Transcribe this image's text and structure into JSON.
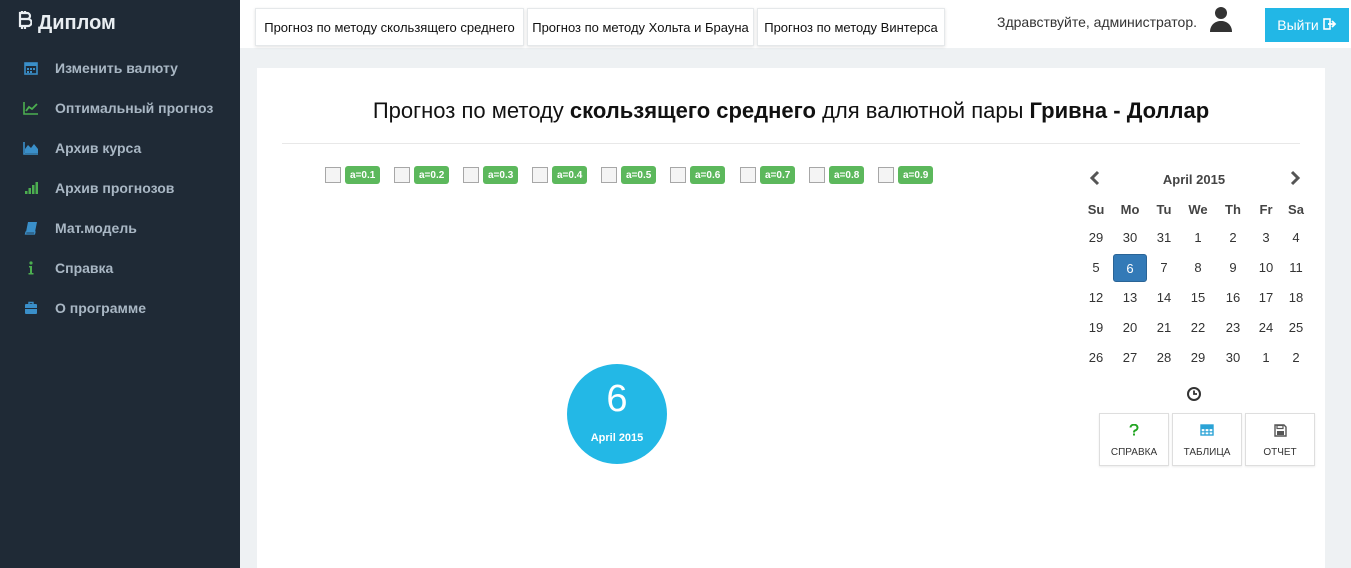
{
  "sidebar": {
    "brand": "Диплом",
    "items": [
      {
        "label": "Изменить валюту",
        "icon": "calendar-icon"
      },
      {
        "label": "Оптимальный прогноз",
        "icon": "line-chart-icon"
      },
      {
        "label": "Архив курса",
        "icon": "area-chart-icon"
      },
      {
        "label": "Архив прогнозов",
        "icon": "signal-bars-icon"
      },
      {
        "label": "Мат.модель",
        "icon": "book-icon"
      },
      {
        "label": "Справка",
        "icon": "info-icon"
      },
      {
        "label": "О программе",
        "icon": "briefcase-icon"
      }
    ]
  },
  "header": {
    "tabs": [
      "Прогноз по методу скользящего среднего",
      "Прогноз по методу Хольта и Брауна",
      "Прогноз по методу Винтерса"
    ],
    "greeting": "Здравствуйте, администратор.",
    "logout_label": "Выйти"
  },
  "main": {
    "title_parts": [
      "Прогноз по методу ",
      "скользящего среднего",
      " для валютной пары ",
      "Гривна - Доллар"
    ],
    "alphas": [
      "a=0.1",
      "a=0.2",
      "a=0.3",
      "a=0.4",
      "a=0.5",
      "a=0.6",
      "a=0.7",
      "a=0.8",
      "a=0.9"
    ],
    "selected_date": {
      "day": "6",
      "month_year": "April 2015"
    }
  },
  "calendar": {
    "title": "April 2015",
    "weekdays": [
      "Su",
      "Mo",
      "Tu",
      "We",
      "Th",
      "Fr",
      "Sa"
    ],
    "weeks": [
      [
        "29",
        "30",
        "31",
        "1",
        "2",
        "3",
        "4"
      ],
      [
        "5",
        "6",
        "7",
        "8",
        "9",
        "10",
        "11"
      ],
      [
        "12",
        "13",
        "14",
        "15",
        "16",
        "17",
        "18"
      ],
      [
        "19",
        "20",
        "21",
        "22",
        "23",
        "24",
        "25"
      ],
      [
        "26",
        "27",
        "28",
        "29",
        "30",
        "1",
        "2"
      ]
    ],
    "active_day": "6"
  },
  "actions": [
    {
      "label": "СПРАВКА",
      "icon": "question-icon"
    },
    {
      "label": "ТАБЛИЦА",
      "icon": "table-icon"
    },
    {
      "label": "ОТЧЕТ",
      "icon": "save-icon"
    }
  ],
  "colors": {
    "sidebar_bg": "#1f2a36",
    "accent": "#23b8e6",
    "label_green": "#5cb85c",
    "active_day": "#337ab7"
  }
}
